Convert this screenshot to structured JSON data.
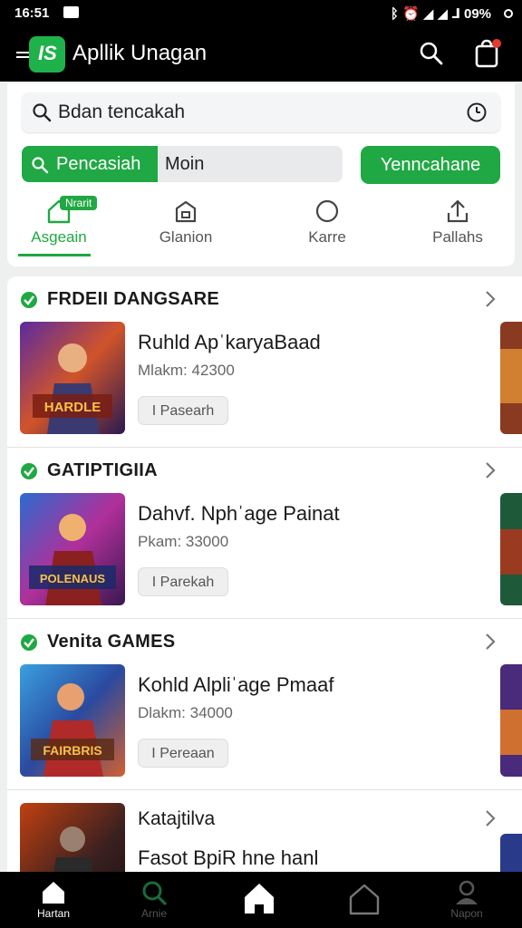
{
  "status_bar": {
    "time": "16:51",
    "right_text": "ᛒ ⏰ ◢ ◢ ⅃ 09%"
  },
  "app_bar": {
    "title": "Apllik Unagan",
    "logo_text": "IS"
  },
  "search": {
    "value": "Bdan tencakah"
  },
  "segment": {
    "active_label": "Pencasiah",
    "inactive_label": "Moin"
  },
  "primary_button": {
    "label": "Yenncahane"
  },
  "category_tabs": [
    {
      "label": "Asgeain",
      "badge": "Nrarit",
      "icon": "home-icon"
    },
    {
      "label": "Glanion",
      "icon": "house-outline-icon"
    },
    {
      "label": "Karre",
      "icon": "circle-icon"
    },
    {
      "label": "Pallahs",
      "icon": "share-icon"
    }
  ],
  "sections": [
    {
      "title": "FRDEII DANGSARE",
      "item_title": "Ruhld ApˈkaryaBaad",
      "item_meta": "Mlakm: 42300",
      "button_label": "I Pasearh",
      "thumb_text": "HARDLE"
    },
    {
      "title": "GATIPTIGIIA",
      "item_title": "Dahvf. Nphˈage Painat",
      "item_meta": "Pkam: 33000",
      "button_label": "I Parekah",
      "thumb_text": "POLENAUS"
    },
    {
      "title": "Venita GAMES",
      "item_title": "Kohld Alpliˈage Pmaaf",
      "item_meta": "Dlakm: 34000",
      "button_label": "I Pereaan",
      "thumb_text": "FAIRBRIS"
    },
    {
      "title": "Katajtilva",
      "item_title": "Fasot BpiR hne hanl",
      "item_meta": "",
      "button_label": "",
      "thumb_text": ""
    }
  ],
  "bottom_nav": [
    {
      "label": "Hartan",
      "icon": "home-icon",
      "active": true
    },
    {
      "label": "Arnie",
      "icon": "search-icon",
      "active": false
    },
    {
      "label": "",
      "icon": "home-icon",
      "active": false
    },
    {
      "label": "",
      "icon": "home-outline-icon",
      "active": false
    },
    {
      "label": "Napon",
      "icon": "profile-icon",
      "active": false
    }
  ],
  "colors": {
    "accent": "#1fa843",
    "bar_bg": "#000000",
    "page_bg": "#eef0f0"
  }
}
